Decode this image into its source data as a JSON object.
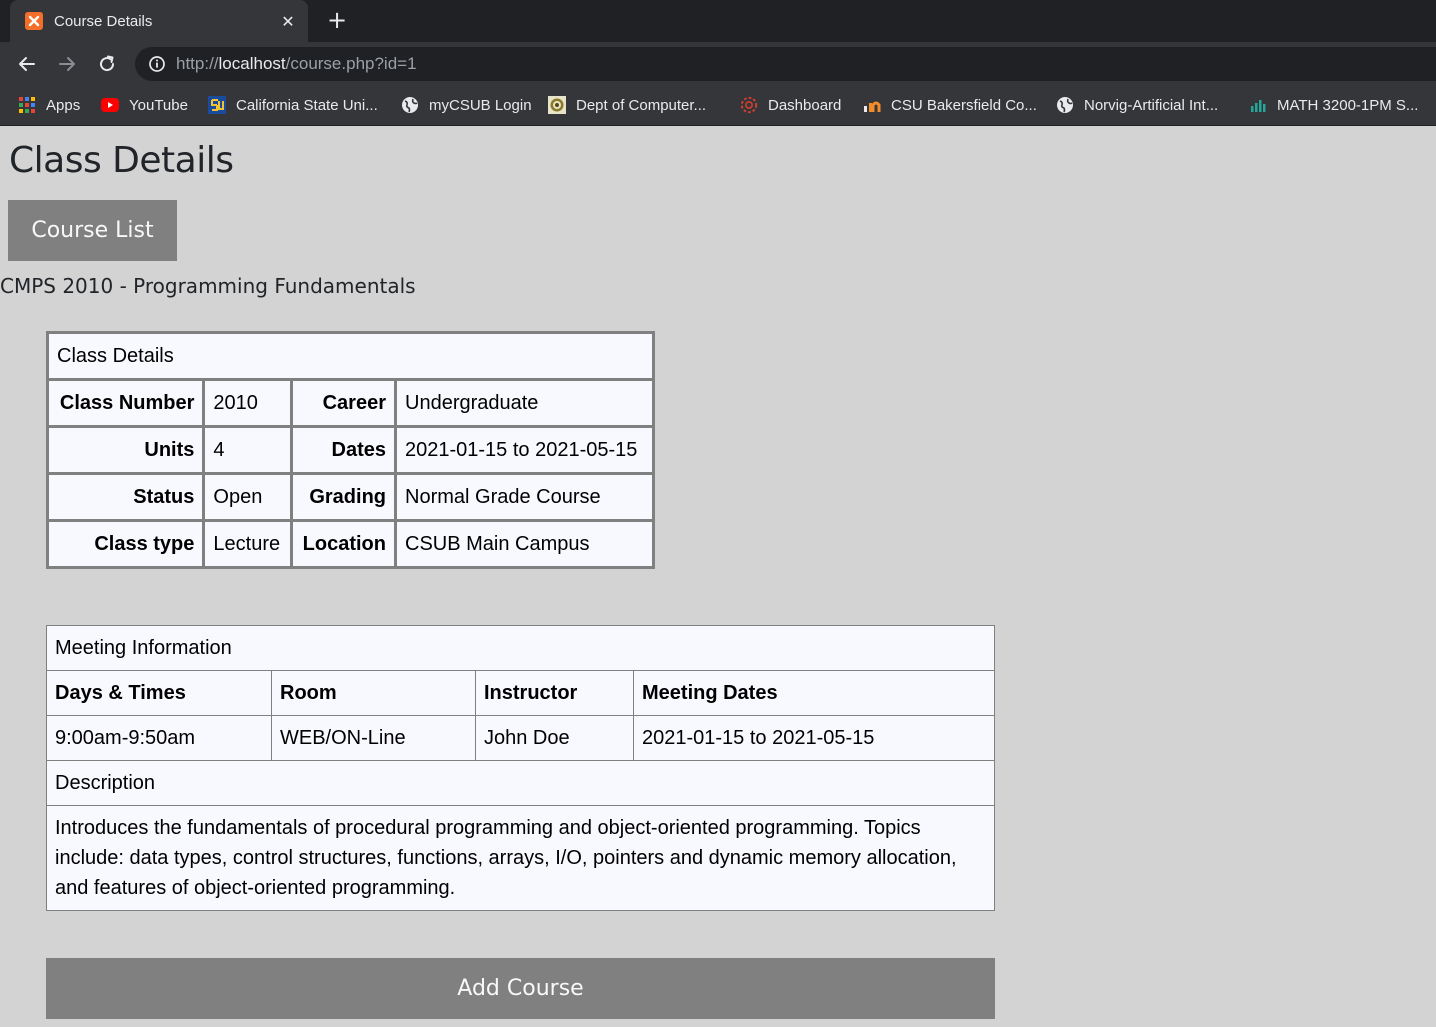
{
  "browser": {
    "tab_title": "Course Details",
    "tab_favicon_glyph": "ꙮ",
    "close_glyph": "✕",
    "new_tab_glyph": "+",
    "url_scheme": "http://",
    "url_host": "localhost",
    "url_path": "/course.php?id=1",
    "bookmarks": [
      {
        "label": "Apps",
        "icon": "apps-grid-icon"
      },
      {
        "label": "YouTube",
        "icon": "youtube-icon"
      },
      {
        "label": "California State Uni...",
        "icon": "csu-logo-icon"
      },
      {
        "label": "myCSUB Login",
        "icon": "globe-icon"
      },
      {
        "label": "Dept of Computer...",
        "icon": "dept-seal-icon"
      },
      {
        "label": "Dashboard",
        "icon": "canvas-icon"
      },
      {
        "label": "CSU Bakersfield Co...",
        "icon": "chart-bars-orange-icon"
      },
      {
        "label": "Norvig-Artificial Int...",
        "icon": "globe-icon"
      },
      {
        "label": "MATH 3200-1PM S...",
        "icon": "chart-bars-teal-icon"
      }
    ],
    "colors": {
      "chrome_dark": "#202124",
      "chrome": "#35363a",
      "text": "#e8eaed"
    }
  },
  "page": {
    "title": "Class Details",
    "course_list_label": "Course List",
    "course_name": "CMPS 2010 - Programming Fundamentals",
    "add_course_label": "Add Course",
    "colors": {
      "background": "#d3d3d3",
      "button": "#808080",
      "table": "#f8f8ff"
    }
  },
  "details": {
    "caption": "Class Details",
    "rows": [
      {
        "l1": "Class Number",
        "v1": "2010",
        "l2": "Career",
        "v2": "Undergraduate"
      },
      {
        "l1": "Units",
        "v1": "4",
        "l2": "Dates",
        "v2": "2021-01-15 to 2021-05-15"
      },
      {
        "l1": "Status",
        "v1": "Open",
        "l2": "Grading",
        "v2": "Normal Grade Course"
      },
      {
        "l1": "Class type",
        "v1": "Lecture",
        "l2": "Location",
        "v2": "CSUB Main Campus"
      }
    ]
  },
  "meeting": {
    "caption": "Meeting Information",
    "headers": [
      "Days & Times",
      "Room",
      "Instructor",
      "Meeting Dates"
    ],
    "row": [
      "9:00am-9:50am",
      "WEB/ON-Line",
      "John Doe",
      "2021-01-15 to 2021-05-15"
    ],
    "description_label": "Description",
    "description": "Introduces the fundamentals of procedural programming and object-oriented programming. Topics include: data types, control structures, functions, arrays, I/O, pointers and dynamic memory allocation, and features of object-oriented programming."
  }
}
